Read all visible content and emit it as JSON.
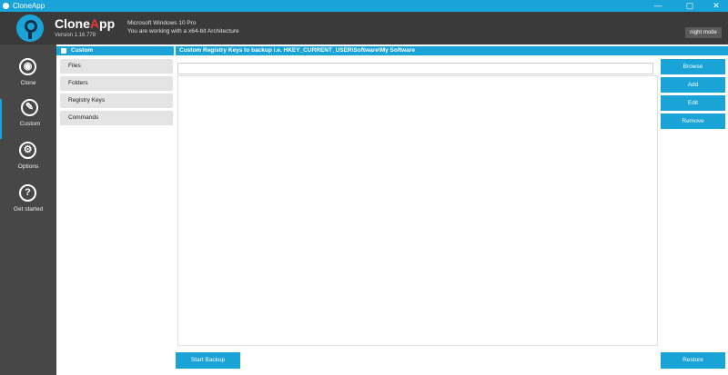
{
  "window": {
    "title": "CloneApp",
    "controls": {
      "minimize": "—",
      "maximize": "▢",
      "close": "✕"
    }
  },
  "header": {
    "brand_main": "Clone",
    "brand_accent": "A",
    "brand_rest": "pp",
    "version": "Version 1.16.778",
    "os": "Microsoft Windows 10 Pro",
    "architecture": "You are working with a x64-bit Architecture",
    "night_mode": "night mode"
  },
  "nav": {
    "items": [
      {
        "label": "Clone",
        "icon": "clone-icon",
        "glyph": "◉"
      },
      {
        "label": "Custom",
        "icon": "custom-icon",
        "glyph": "✎"
      },
      {
        "label": "Options",
        "icon": "gear-icon",
        "glyph": "⚙"
      },
      {
        "label": "Get started",
        "icon": "question-icon",
        "glyph": "?"
      }
    ]
  },
  "custom_panel": {
    "header": "Custom",
    "items": [
      "Files",
      "Folders",
      "Registry Keys",
      "Commands"
    ]
  },
  "content": {
    "header": "Custom Registry Keys to backup i.e. HKEY_CURRENT_USER\\Software\\My Software",
    "path_value": ""
  },
  "buttons": {
    "browse": "Browse",
    "add": "Add",
    "edit": "Edit",
    "remove": "Remove",
    "start_backup": "Start Backup",
    "restore": "Restore"
  },
  "colors": {
    "accent": "#1aa3d6",
    "header_bg": "#3a3a3a",
    "nav_bg": "#474747"
  }
}
